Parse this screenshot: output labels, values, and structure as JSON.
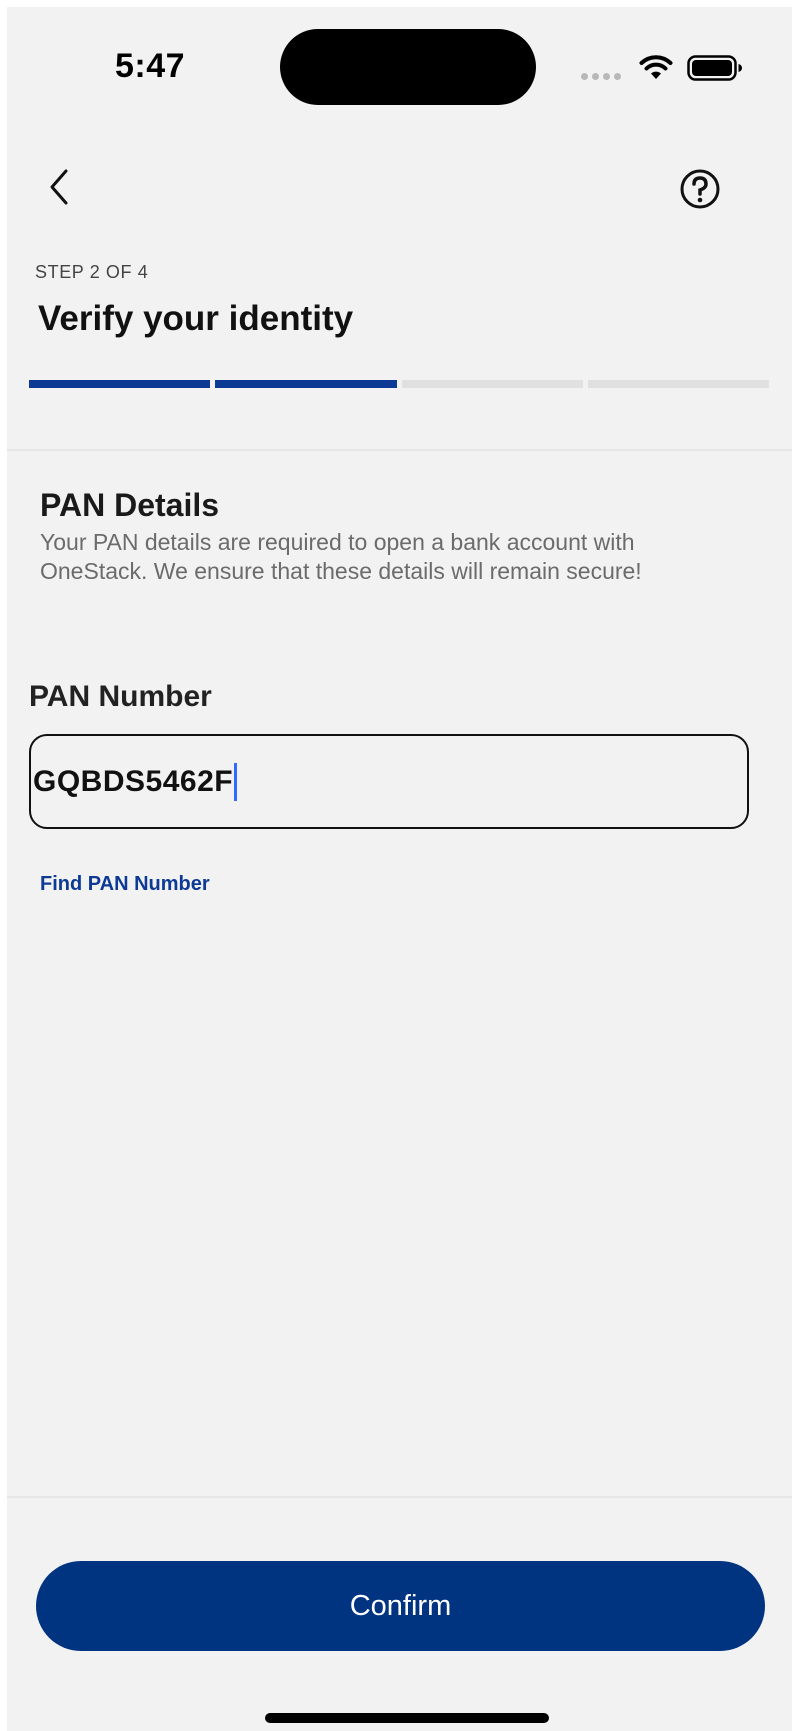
{
  "status_bar": {
    "time": "5:47",
    "icons": [
      "signal-dots-icon",
      "wifi-icon",
      "battery-icon"
    ]
  },
  "nav": {
    "back_icon": "chevron-left-icon",
    "help_icon": "question-circle-icon"
  },
  "header": {
    "step_label": "STEP 2 OF 4",
    "title": "Verify your identity",
    "progress": {
      "current_step": 2,
      "total_steps": 4
    }
  },
  "section": {
    "title": "PAN Details",
    "description": "Your PAN details are required to open a bank account with OneStack. We ensure that these details will remain secure!"
  },
  "form": {
    "pan_label": "PAN Number",
    "pan_value": "GQBDS5462F",
    "find_link": "Find PAN Number"
  },
  "footer": {
    "confirm_label": "Confirm"
  },
  "colors": {
    "accent": "#0c3a94",
    "button": "#003380",
    "background": "#f2f2f2",
    "caret": "#2f6bff"
  }
}
